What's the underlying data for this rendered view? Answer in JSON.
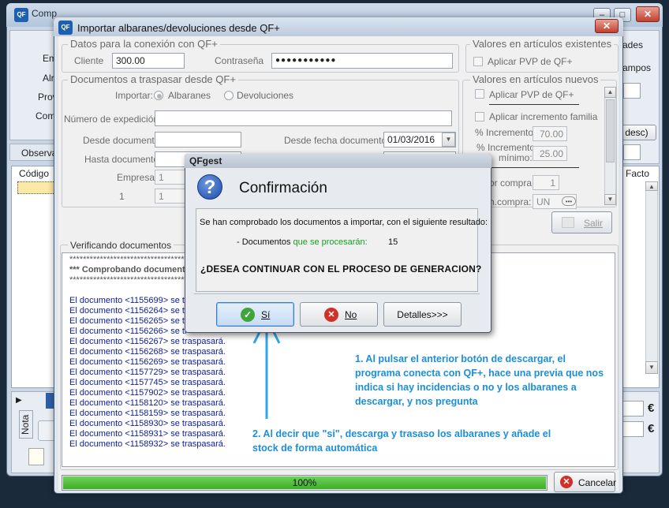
{
  "background_app": {
    "title": "Comp",
    "labels": [
      "Em",
      "Alr",
      "Prov",
      "Com"
    ],
    "right_labels": [
      "ades",
      "ampos",
      "desc)"
    ],
    "grid_headers": [
      "Código",
      "Facto"
    ],
    "tab_label": "Observa",
    "side_tab": "Nota",
    "currency": "€"
  },
  "dialog": {
    "title": "Importar albaranes/devoluciones desde QF+",
    "close_glyph": "✕",
    "conexion": {
      "legend": "Datos para la conexión con QF+",
      "cliente_label": "Cliente",
      "cliente_value": "300.00",
      "contrasena_label": "Contraseña",
      "contrasena_value": "●●●●●●●●●●●"
    },
    "documentos": {
      "legend": "Documentos a traspasar desde QF+",
      "importar_label": "Importar:",
      "option_albaranes": "Albaranes",
      "option_devoluciones": "Devoluciones",
      "expedicion_label": "Número de expedición:",
      "desde_doc_label": "Desde documento",
      "hasta_doc_label": "Hasta documento",
      "empresa_label": "Empresa",
      "empresa_value": "1",
      "almacen_label": "Almacén",
      "almacen_value": "1",
      "desde_fecha_label": "Desde fecha documento:",
      "desde_fecha_value": "01/03/2016"
    },
    "existentes": {
      "legend": "Valores en artículos existentes",
      "aplicar_pvp": "Aplicar PVP de QF+"
    },
    "nuevos": {
      "legend": "Valores en artículos nuevos",
      "aplicar_pvp": "Aplicar PVP de QF+",
      "aplicar_incremento": "Aplicar incremento familia",
      "pct_incremento_label": "% Incremento:",
      "pct_incremento_value": "70.00",
      "pct_minimo_label_1": "% Incremento",
      "pct_minimo_label_2": "mínimo:",
      "pct_minimo_value": "25.00",
      "ud_compra_label": "or compra",
      "ud_compra_value": "1",
      "un_compra_label": "n.compra:",
      "un_compra_value": "UN"
    },
    "salir_label": "Salir",
    "verificando_legend": "Verificando documentos",
    "log": {
      "stars": "******************************************************************************",
      "comprobando": "***  Comprobando documentos",
      "entries": [
        {
          "doc": "El documento <1155699> se traspasará.",
          "visible": "El documento <1155699> se tr"
        },
        {
          "doc": "El documento <1156264> se traspasará.",
          "visible": "El documento <1156264> se tr"
        },
        {
          "doc": "El documento <1156265> se traspasará.",
          "visible": "El documento <1156265> se tr"
        },
        {
          "doc": "El documento <1156266> se traspasará.",
          "visible": "El documento <1156266> se tr"
        },
        {
          "doc": "El documento <1156267> se traspasará.",
          "visible": "El documento <1156267> se traspasará."
        },
        {
          "doc": "El documento <1156268> se traspasará.",
          "visible": "El documento <1156268> se traspasará."
        },
        {
          "doc": "El documento <1156269> se traspasará.",
          "visible": "El documento <1156269> se traspasará."
        },
        {
          "doc": "El documento <1157729> se traspasará.",
          "visible": "El documento <1157729> se traspasará."
        },
        {
          "doc": "El documento <1157745> se traspasará.",
          "visible": "El documento <1157745> se traspasará."
        },
        {
          "doc": "El documento <1157902> se traspasará.",
          "visible": "El documento <1157902> se traspasará."
        },
        {
          "doc": "El documento <1158120> se traspasará.",
          "visible": "El documento <1158120> se traspasará."
        },
        {
          "doc": "El documento <1158159> se traspasará.",
          "visible": "El documento <1158159> se traspasará."
        },
        {
          "doc": "El documento <1158930> se traspasará.",
          "visible": "El documento <1158930> se traspasará."
        },
        {
          "doc": "El documento <1158931> se traspasará.",
          "visible": "El documento <1158931> se traspasará."
        },
        {
          "doc": "El documento <1158932> se traspasará.",
          "visible": "El documento <1158932> se traspasará."
        }
      ]
    },
    "progress_text": "100%",
    "progress_fraction": 1.0,
    "cancelar_label": "Cancelar"
  },
  "confirm": {
    "window_title": "QFgest",
    "heading": "Confirmación",
    "message": "Se han comprobado los documentos a importar, con el siguiente resultado:",
    "docs_prefix": "- Documentos",
    "docs_highlight": "que se procesarán:",
    "docs_count": "15",
    "question": "¿DESEA CONTINUAR CON EL PROCESO DE GENERACION?",
    "btn_si": "Sí",
    "btn_no": "No",
    "btn_detalles": "Detalles>>>"
  },
  "annotations": {
    "note1": "1. Al pulsar el anterior botón de descargar, el programa conecta con QF+, hace una previa que nos indica si hay incidencias o no y los albaranes a descargar,  y nos pregunta",
    "note2": "2. Al decir que \"si\", descarga y trasaso los albaranes y añade el stock de forma automática"
  },
  "colors": {
    "annotation": "#1b8fd8",
    "log_text": "#10209a",
    "highlight_green": "#14a01e",
    "progress_green": "#3cae27"
  }
}
